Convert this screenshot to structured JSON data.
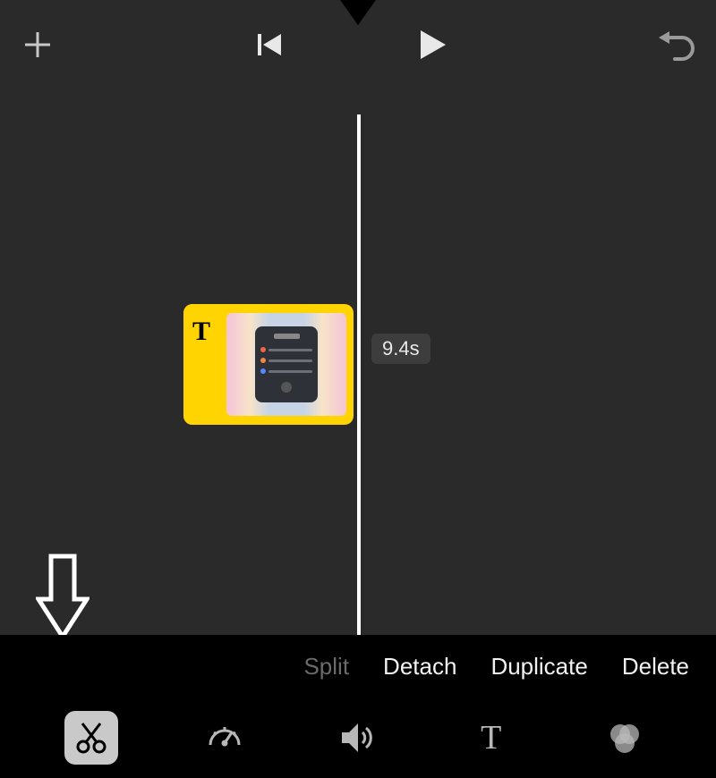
{
  "clip": {
    "title_glyph": "T",
    "duration_label": "9.4s"
  },
  "actions": {
    "split": "Split",
    "detach": "Detach",
    "duplicate": "Duplicate",
    "delete": "Delete"
  },
  "tools": {
    "active": "trim"
  },
  "icons": {
    "add": "add-icon",
    "rewind": "skip-start-icon",
    "play": "play-icon",
    "undo": "undo-icon",
    "trim": "scissors-icon",
    "speed": "speedometer-icon",
    "volume": "volume-icon",
    "text": "text-icon",
    "filters": "filters-icon"
  }
}
